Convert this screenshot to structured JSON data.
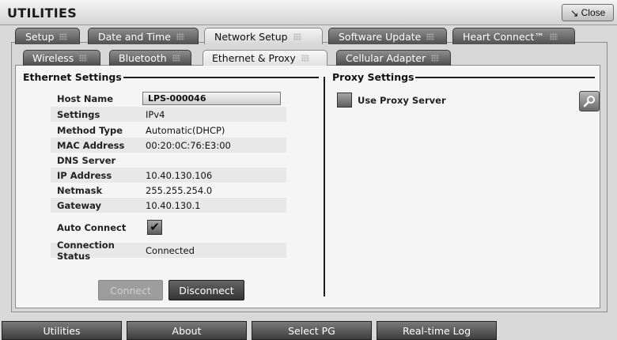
{
  "app": {
    "title": "UTILITIES",
    "close_label": "Close"
  },
  "tabs": [
    {
      "label": "Setup",
      "active": false
    },
    {
      "label": "Date and Time",
      "active": false
    },
    {
      "label": "Network Setup",
      "active": true
    },
    {
      "label": "Software Update",
      "active": false
    },
    {
      "label": "Heart Connect™",
      "active": false
    }
  ],
  "subtabs": [
    {
      "label": "Wireless",
      "active": false
    },
    {
      "label": "Bluetooth",
      "active": false
    },
    {
      "label": "Ethernet & Proxy",
      "active": true
    },
    {
      "label": "Cellular Adapter",
      "active": false
    }
  ],
  "ethernet": {
    "title": "Ethernet Settings",
    "host_name_label": "Host Name",
    "host_name_value": "LPS-000046",
    "fields": [
      {
        "label": "Settings",
        "value": "IPv4"
      },
      {
        "label": "Method Type",
        "value": "Automatic(DHCP)"
      },
      {
        "label": "MAC Address",
        "value": "00:20:0C:76:E3:00"
      },
      {
        "label": "DNS Server",
        "value": ""
      },
      {
        "label": "IP Address",
        "value": "10.40.130.106"
      },
      {
        "label": "Netmask",
        "value": "255.255.254.0"
      },
      {
        "label": "Gateway",
        "value": "10.40.130.1"
      }
    ],
    "auto_connect_label": "Auto Connect",
    "auto_connect_checked": true,
    "connection_status_label": "Connection Status",
    "connection_status_value": "Connected",
    "connect_label": "Connect",
    "disconnect_label": "Disconnect"
  },
  "proxy": {
    "title": "Proxy Settings",
    "use_proxy_label": "Use Proxy Server",
    "use_proxy_checked": false
  },
  "bottom_bar": [
    {
      "label": "Utilities"
    },
    {
      "label": "About"
    },
    {
      "label": "Select PG"
    },
    {
      "label": "Real-time Log"
    }
  ]
}
